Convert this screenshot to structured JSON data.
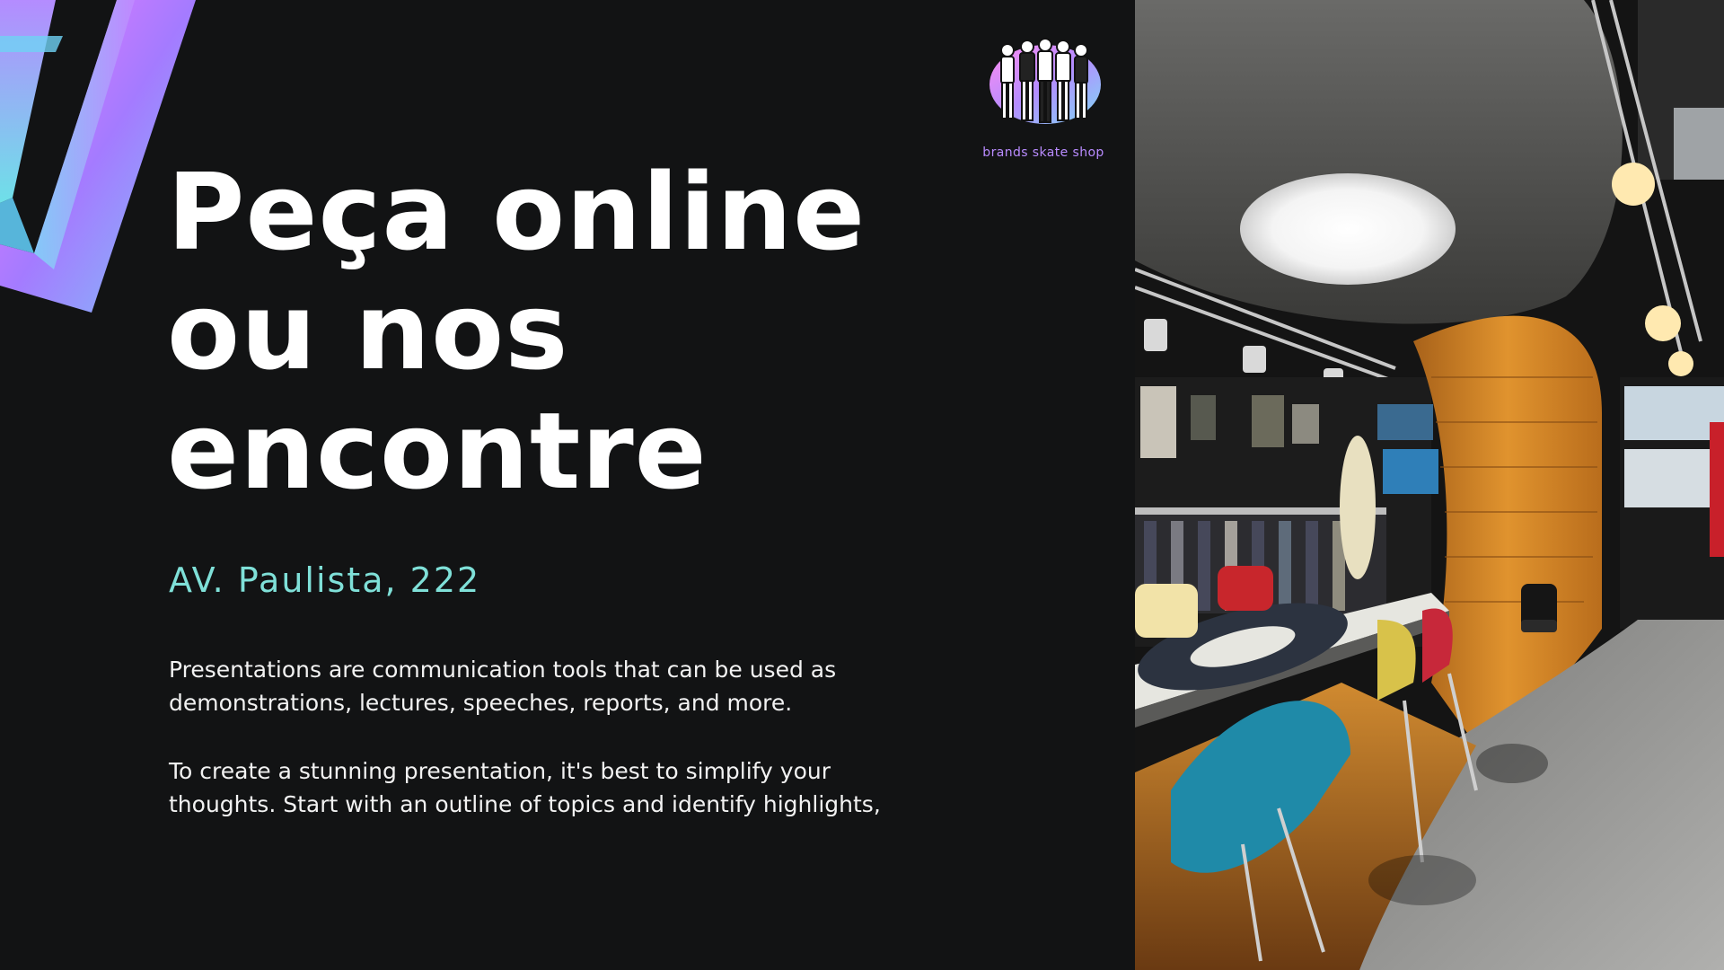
{
  "slide": {
    "headline_lines": [
      "Peça online",
      "ou nos",
      "encontre"
    ],
    "address": "AV. Paulista, 222",
    "paragraph_1_lines": [
      "Presentations are communication tools that can be used as",
      "demonstrations, lectures, speeches, reports, and more."
    ],
    "paragraph_2_lines": [
      "To create a stunning presentation, it's best to simplify your",
      "thoughts. Start with an outline of topics and identify highlights,"
    ]
  },
  "brand": {
    "name": "brands skate shop",
    "logo_icon": "group-of-people-illustration"
  },
  "photo": {
    "subject": "skate-shop-interior-photo"
  },
  "colors": {
    "background": "#121314",
    "headline": "#ffffff",
    "address": "#7fe0d8",
    "body_text": "#f2f2f2",
    "brand_text": "#b98bff"
  }
}
